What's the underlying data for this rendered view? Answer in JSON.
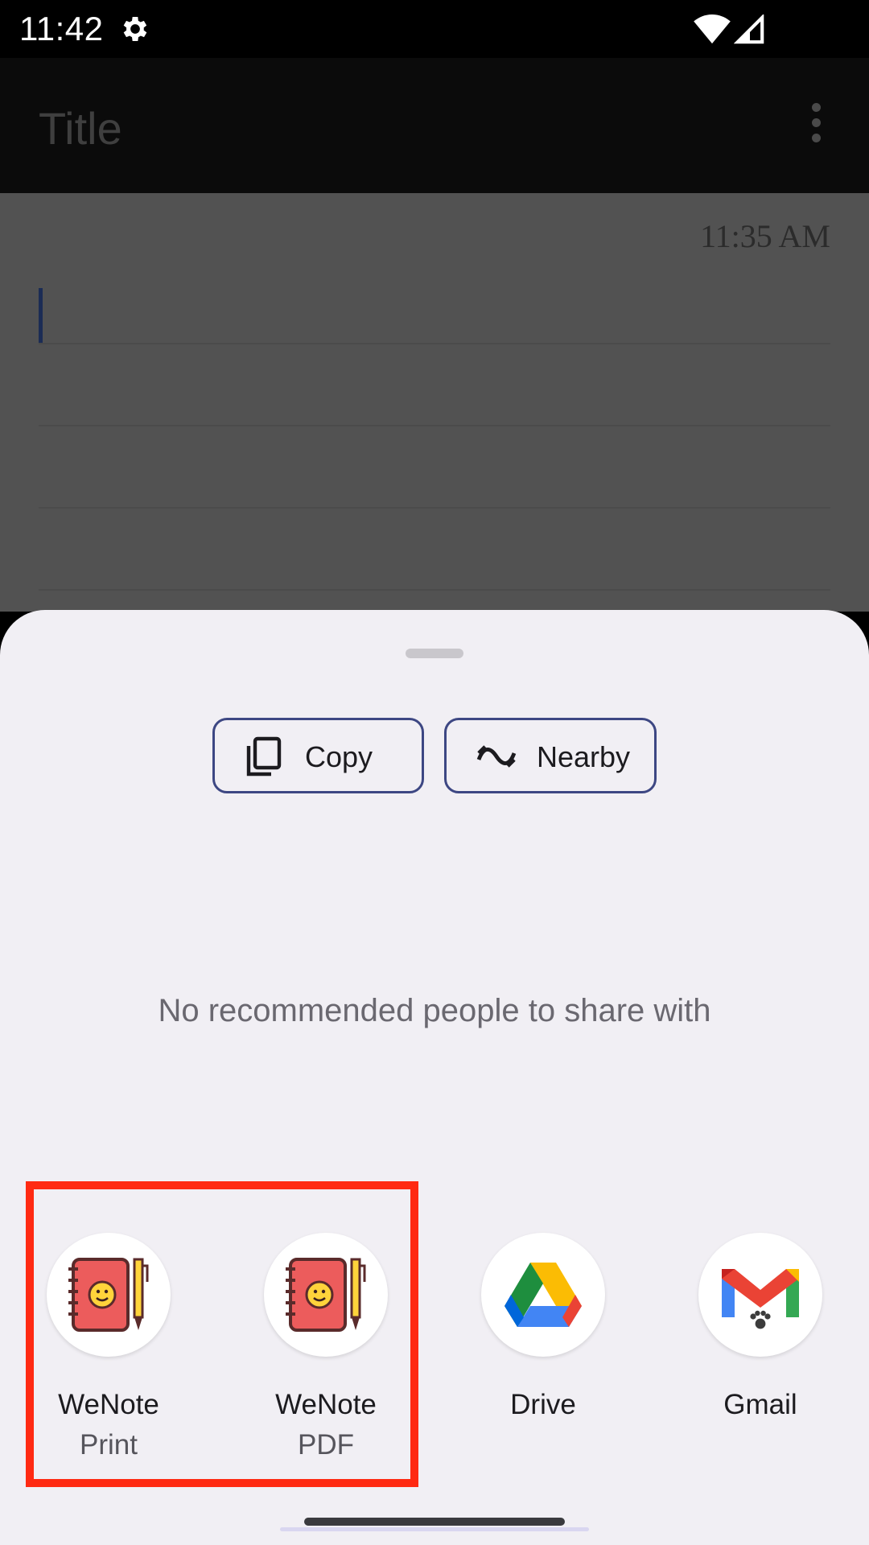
{
  "status_bar": {
    "time": "11:42",
    "icons": [
      "settings-icon",
      "wifi-icon",
      "cell-signal-icon"
    ]
  },
  "note": {
    "title_placeholder": "Title",
    "timestamp": "11:35 AM"
  },
  "share_sheet": {
    "actions": [
      {
        "label": "Copy",
        "icon": "copy-icon"
      },
      {
        "label": "Nearby",
        "icon": "nearby-share-icon"
      }
    ],
    "empty_people_text": "No recommended people to share with",
    "apps": [
      {
        "name": "WeNote",
        "subtitle": "Print",
        "icon": "wenote-notebook-icon"
      },
      {
        "name": "WeNote",
        "subtitle": "PDF",
        "icon": "wenote-notebook-icon"
      },
      {
        "name": "Drive",
        "subtitle": "",
        "icon": "google-drive-icon"
      },
      {
        "name": "Gmail",
        "subtitle": "",
        "icon": "gmail-icon"
      }
    ]
  },
  "colors": {
    "sheet_background": "#f1eff4",
    "chip_border": "#3d4783",
    "highlight": "#ff2a12"
  }
}
